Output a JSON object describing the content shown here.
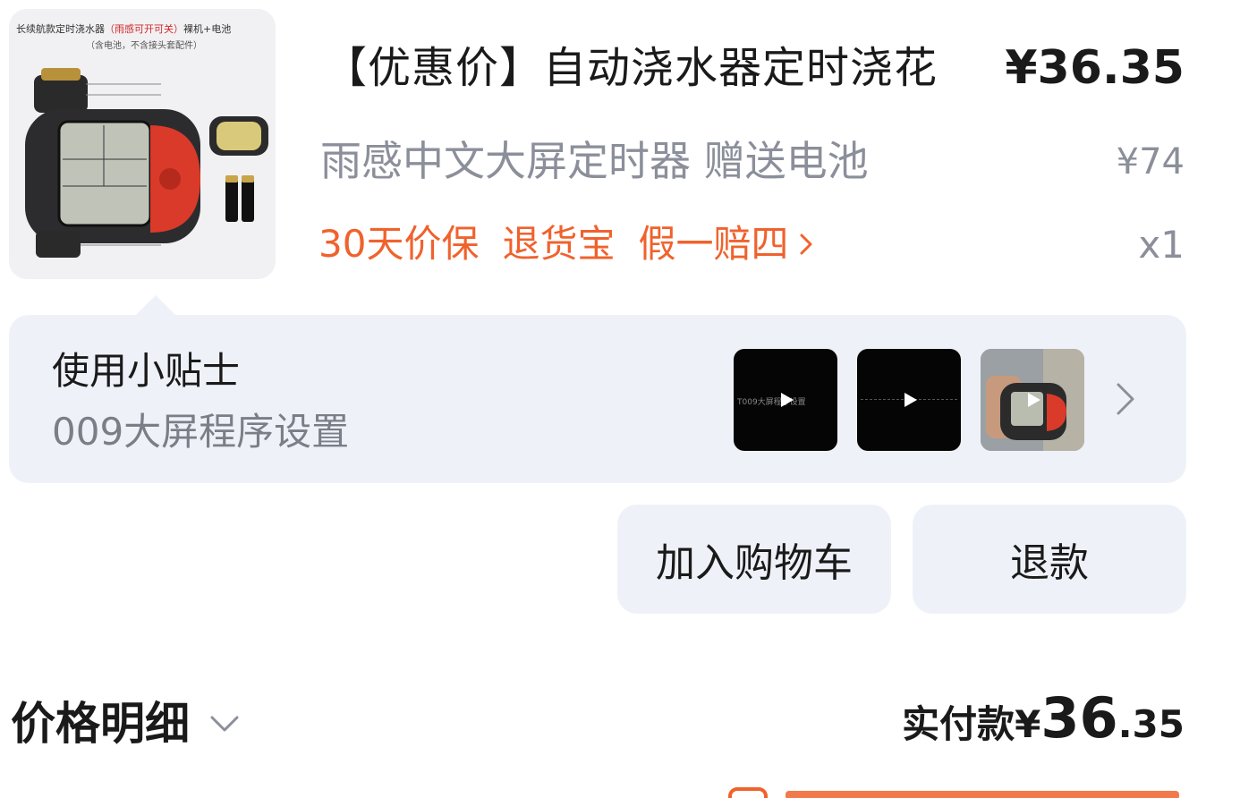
{
  "product": {
    "title": "【优惠价】自动浇水器定时浇花",
    "price": "¥36.35",
    "spec": "雨感中文大屏定时器 赠送电池",
    "original_price": "¥74",
    "quantity": "x1",
    "services": [
      "30天价保",
      "退货宝",
      "假一赔四"
    ],
    "image": {
      "caption_line1_a": "长续航款定时浇水器",
      "caption_line1_red": "（雨感可开可关）",
      "caption_line1_b": "裸机+电池",
      "caption_line2": "（含电池，不含接头套配件）"
    }
  },
  "tips": {
    "title": "使用小贴士",
    "subtitle": "009大屏程序设置",
    "videos": [
      {
        "overlay_text": "T009大屏程序设置"
      },
      {
        "overlay_text": ""
      },
      {
        "overlay_text": ""
      }
    ]
  },
  "actions": {
    "add_to_cart": "加入购物车",
    "refund": "退款"
  },
  "price_detail": {
    "label": "价格明细",
    "paid_label": "实付款",
    "currency": "¥",
    "paid_integer": "36",
    "paid_decimal": ".35"
  },
  "colors": {
    "accent_orange": "#f0622d",
    "muted_text": "#8b8f9a",
    "card_bg": "#eef2f8"
  }
}
